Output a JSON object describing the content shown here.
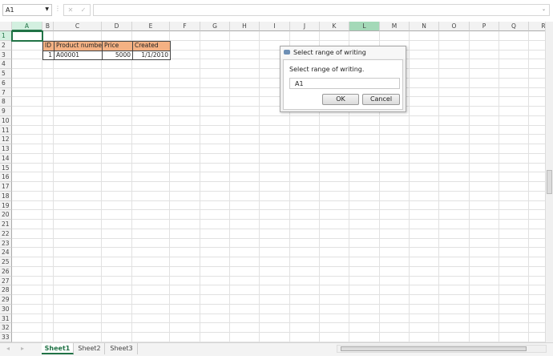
{
  "formula_bar": {
    "name_box": "A1",
    "formula": ""
  },
  "columns": [
    "A",
    "B",
    "C",
    "D",
    "E",
    "F",
    "G",
    "H",
    "I",
    "J",
    "K",
    "L",
    "M",
    "N",
    "O",
    "P",
    "Q",
    "R"
  ],
  "selected_column": "A",
  "highlighted_column": "L",
  "selected_row": 1,
  "row_count": 33,
  "table": {
    "headers": [
      "ID",
      "Product number",
      "Price",
      "Created"
    ],
    "rows": [
      [
        "1",
        "A00001",
        "5000",
        "1/1/2010"
      ]
    ],
    "header_color": "#f4b183"
  },
  "dialog": {
    "title": "Select range of writing",
    "label": "Select range of writing.",
    "input_value": "A1",
    "ok": "OK",
    "cancel": "Cancel"
  },
  "sheets": [
    "Sheet1",
    "Sheet2",
    "Sheet3"
  ],
  "active_sheet": "Sheet1",
  "accent": "#217346"
}
